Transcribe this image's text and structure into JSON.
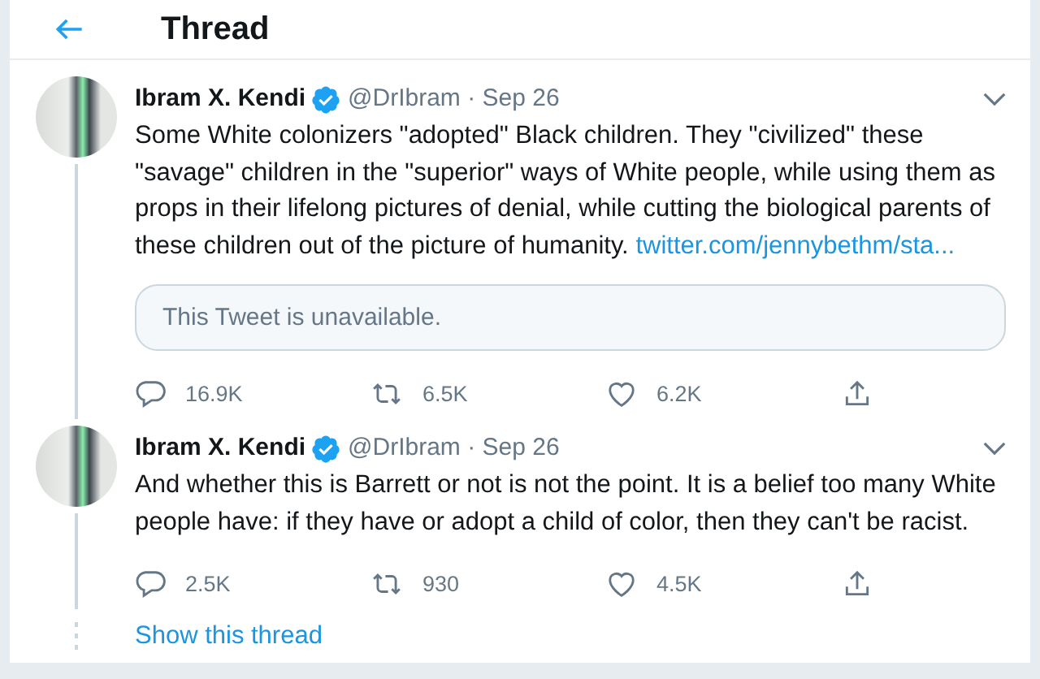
{
  "header": {
    "title": "Thread"
  },
  "tweets": [
    {
      "name": "Ibram X. Kendi",
      "verified": true,
      "handle": "@DrIbram",
      "separator": "·",
      "date": "Sep 26",
      "text": "Some White colonizers \"adopted\" Black children. They \"civilized\" these \"savage\" children in the \"superior\" ways of White people, while using them as props in their lifelong pictures of denial, while cutting the biological parents of these children out of the picture of humanity.",
      "link": "twitter.com/jennybethm/sta...",
      "quoted": {
        "text": "This Tweet is unavailable."
      },
      "actions": [
        {
          "kind": "reply",
          "count": "16.9K"
        },
        {
          "kind": "retweet",
          "count": "6.5K"
        },
        {
          "kind": "like",
          "count": "6.2K"
        },
        {
          "kind": "share"
        }
      ]
    },
    {
      "name": "Ibram X. Kendi",
      "verified": true,
      "handle": "@DrIbram",
      "separator": "·",
      "date": "Sep 26",
      "text": "And whether this is Barrett or not is not the point. It is a belief too many White people have: if they have or adopt a child of color, then they can't be racist.",
      "actions": [
        {
          "kind": "reply",
          "count": "2.5K"
        },
        {
          "kind": "retweet",
          "count": "930"
        },
        {
          "kind": "like",
          "count": "4.5K"
        },
        {
          "kind": "share"
        }
      ]
    }
  ],
  "show_thread": {
    "label": "Show this thread"
  }
}
